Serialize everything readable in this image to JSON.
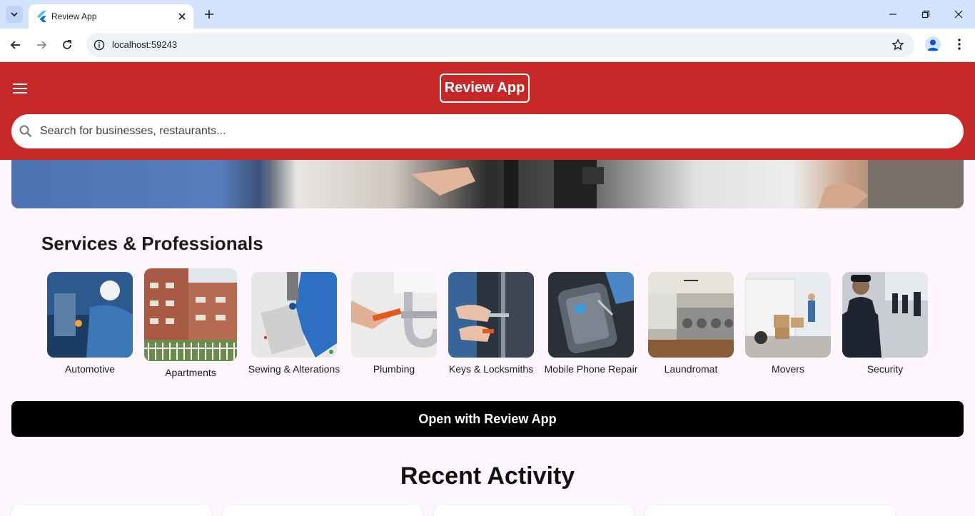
{
  "browser": {
    "tab_title": "Review App",
    "url": "localhost:59243"
  },
  "header": {
    "brand": "Review App",
    "search_placeholder": "Search for businesses, restaurants...",
    "accent_color": "#c62828"
  },
  "services": {
    "title": "Services & Professionals",
    "items": [
      {
        "label": "Automotive",
        "icon": "automotive-image"
      },
      {
        "label": "Apartments",
        "icon": "apartments-image"
      },
      {
        "label": "Sewing & Alterations",
        "icon": "sewing-image"
      },
      {
        "label": "Plumbing",
        "icon": "plumbing-image"
      },
      {
        "label": "Keys & Locksmiths",
        "icon": "locksmith-image"
      },
      {
        "label": "Mobile Phone Repair",
        "icon": "phone-repair-image"
      },
      {
        "label": "Laundromat",
        "icon": "laundromat-image"
      },
      {
        "label": "Movers",
        "icon": "movers-image"
      },
      {
        "label": "Security",
        "icon": "security-image"
      }
    ]
  },
  "cta": {
    "label": "Open with Review App"
  },
  "recent": {
    "title": "Recent Activity"
  }
}
